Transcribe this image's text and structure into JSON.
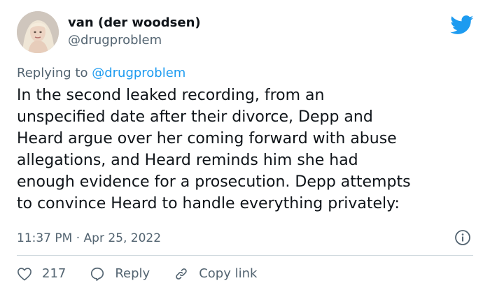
{
  "author": {
    "display_name": "van (der woodsen)",
    "handle": "@drugproblem"
  },
  "reply_context": {
    "prefix": "Replying to ",
    "mention": "@drugproblem"
  },
  "tweet": {
    "text_lines": [
      "In the second leaked recording, from an",
      "unspecified date after their divorce, Depp and",
      "Heard argue over her coming forward with abuse",
      "allegations, and Heard reminds him she had",
      "enough evidence for a prosecution. Depp attempts",
      "to convince Heard to handle everything privately:"
    ],
    "timestamp": "11:37 PM · Apr 25, 2022"
  },
  "actions": {
    "like_count": "217",
    "reply_label": "Reply",
    "copy_link_label": "Copy link"
  },
  "icons": {
    "brand": "twitter-bird-icon",
    "info": "info-icon",
    "like": "heart-icon",
    "reply": "reply-bubble-icon",
    "copy": "link-icon"
  },
  "colors": {
    "brand_blue": "#1d9bf0",
    "text_primary": "#0f1419",
    "text_secondary": "#536471",
    "divider": "#cfd9de"
  }
}
